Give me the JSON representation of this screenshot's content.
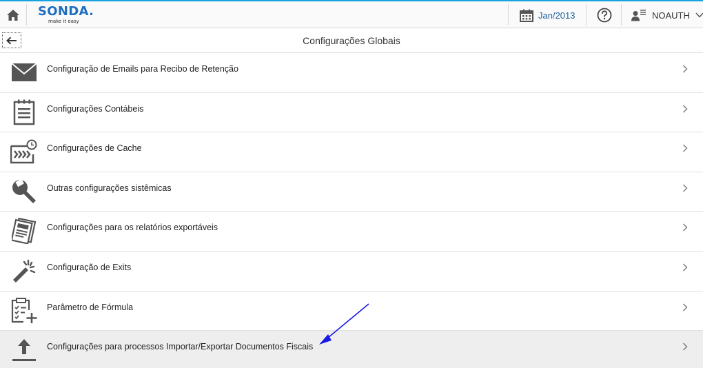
{
  "app": {
    "logo_text": "SONDA.",
    "logo_tagline": "make it easy"
  },
  "topbar": {
    "period": "Jan/2013",
    "user_name": "NOAUTH"
  },
  "page": {
    "title": "Configurações Globais"
  },
  "menu": {
    "items": [
      {
        "label": "Configuração de Emails para Recibo de Retenção",
        "icon": "envelope-icon"
      },
      {
        "label": "Configurações Contábeis",
        "icon": "notepad-icon"
      },
      {
        "label": "Configurações de Cache",
        "icon": "cache-clock-icon"
      },
      {
        "label": "Outras configurações sistêmicas",
        "icon": "wrench-icon"
      },
      {
        "label": "Configurações para os relatórios exportáveis",
        "icon": "report-icon"
      },
      {
        "label": "Configuração de Exits",
        "icon": "magic-wand-icon"
      },
      {
        "label": "Parâmetro de Fórmula",
        "icon": "clipboard-check-add-icon"
      },
      {
        "label": "Configurações para processos Importar/Exportar Documentos Fiscais",
        "icon": "upload-icon"
      }
    ]
  },
  "colors": {
    "accent_border": "#19a3de",
    "logo": "#1f6fc0",
    "icon": "#555555",
    "annotation_arrow": "#1a1ae6",
    "selected_row": "#eeeeee"
  }
}
